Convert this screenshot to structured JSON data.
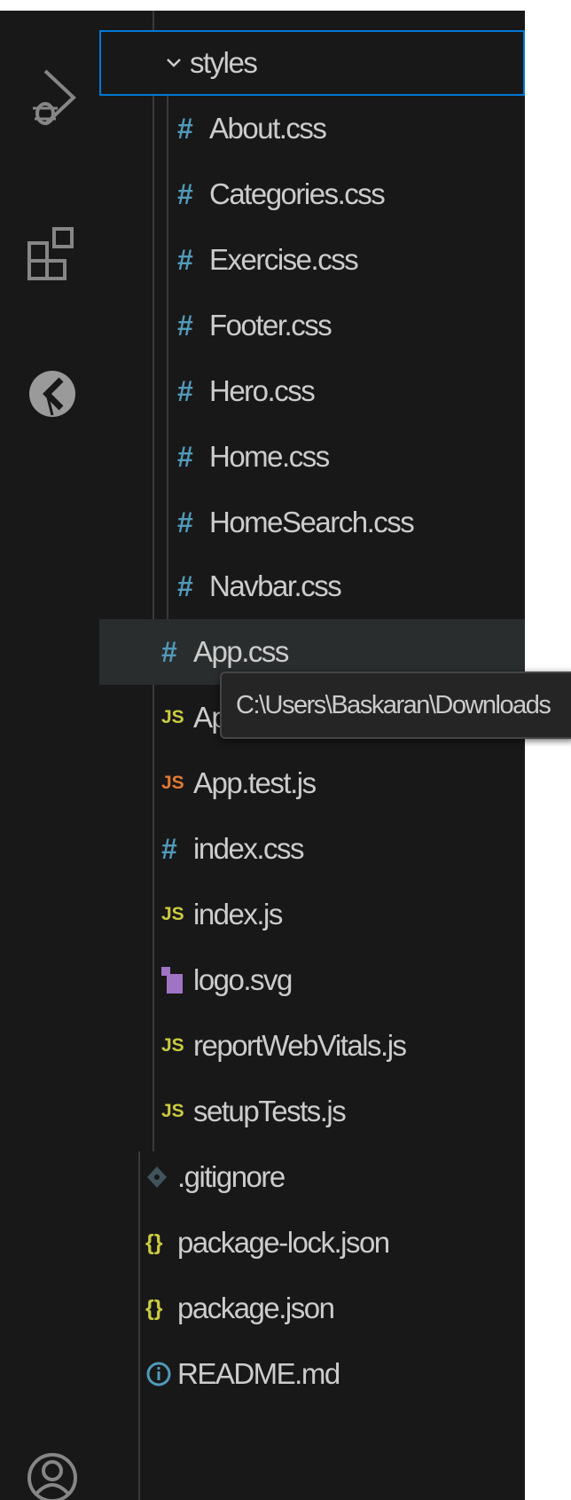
{
  "explorer": {
    "folder": {
      "name": "styles",
      "icon": "chevron-down-icon",
      "files": [
        {
          "name": "About.css",
          "icon": "hash-icon"
        },
        {
          "name": "Categories.css",
          "icon": "hash-icon"
        },
        {
          "name": "Exercise.css",
          "icon": "hash-icon"
        },
        {
          "name": "Footer.css",
          "icon": "hash-icon"
        },
        {
          "name": "Hero.css",
          "icon": "hash-icon"
        },
        {
          "name": "Home.css",
          "icon": "hash-icon"
        },
        {
          "name": "HomeSearch.css",
          "icon": "hash-icon"
        },
        {
          "name": "Navbar.css",
          "icon": "hash-icon"
        }
      ]
    },
    "src_files": [
      {
        "name": "App.css",
        "icon": "hash-icon"
      },
      {
        "name": "App.js",
        "icon": "js-icon"
      },
      {
        "name": "App.test.js",
        "icon": "js-test-icon"
      },
      {
        "name": "index.css",
        "icon": "hash-icon"
      },
      {
        "name": "index.js",
        "icon": "js-icon"
      },
      {
        "name": "logo.svg",
        "icon": "svg-file-icon"
      },
      {
        "name": "reportWebVitals.js",
        "icon": "js-icon"
      },
      {
        "name": "setupTests.js",
        "icon": "js-icon"
      }
    ],
    "root_files": [
      {
        "name": ".gitignore",
        "icon": "git-icon"
      },
      {
        "name": "package-lock.json",
        "icon": "json-icon"
      },
      {
        "name": "package.json",
        "icon": "json-icon"
      },
      {
        "name": "README.md",
        "icon": "info-icon"
      }
    ]
  },
  "tooltip": {
    "text": "C:\\Users\\Baskaran\\Downloads"
  },
  "icons": {
    "hash": "#",
    "js": "JS",
    "json": "{}",
    "info": "i"
  },
  "colors": {
    "background": "#181818",
    "text": "#cccccc",
    "css_icon": "#519aba",
    "js_icon": "#cbcb41",
    "test_icon": "#e37933",
    "svg_icon": "#a074c4",
    "selection_border": "#0078d4"
  },
  "activity_bar": [
    {
      "icon": "run-debug-icon"
    },
    {
      "icon": "extensions-icon"
    },
    {
      "icon": "remote-explorer-icon"
    },
    {
      "icon": "account-icon"
    }
  ]
}
